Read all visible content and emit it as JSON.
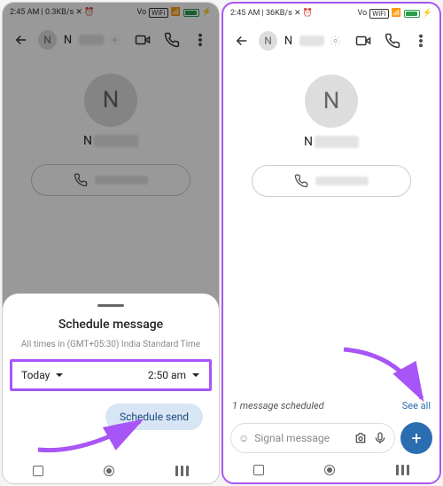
{
  "statusbar": {
    "time": "2:45 AM",
    "rate_left": "0.3KB/s",
    "rate_right": "36KB/s",
    "wifi_label": "WiFi"
  },
  "header": {
    "initial": "N",
    "name": "N"
  },
  "contact": {
    "initial": "N",
    "name": "N"
  },
  "sheet": {
    "title": "Schedule message",
    "tz": "All times in (GMT+05:30) India Standard Time",
    "day": "Today",
    "time": "2:50 am",
    "send_btn": "Schedule send"
  },
  "scheduled": {
    "label": "1 message scheduled",
    "see_all": "See all"
  },
  "compose": {
    "placeholder": "Signal message"
  }
}
